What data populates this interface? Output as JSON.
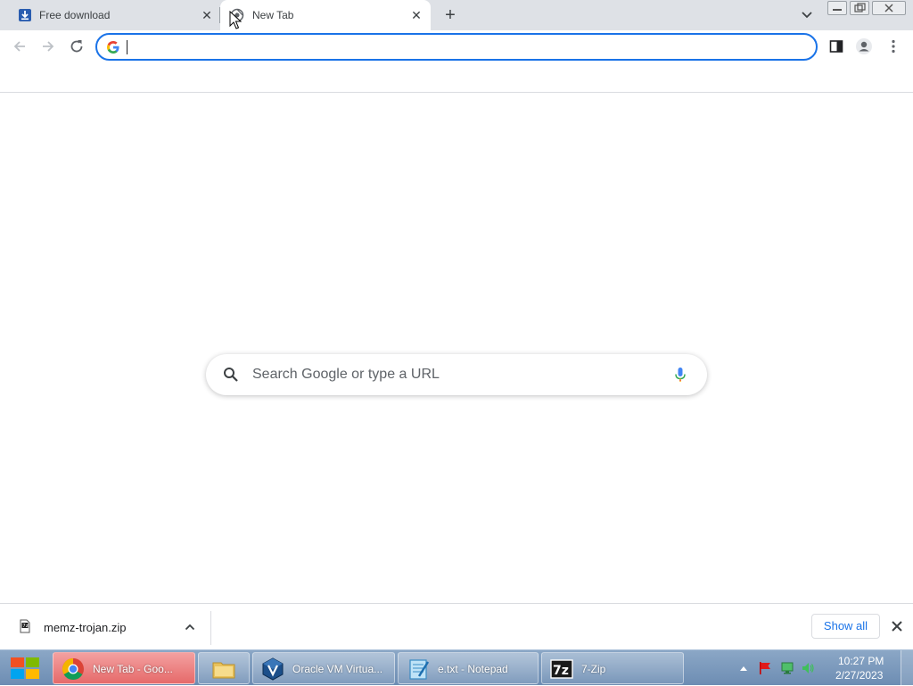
{
  "browser": {
    "tabs": [
      {
        "title": "Free download",
        "favicon": "download-arrow-icon",
        "active": false
      },
      {
        "title": "New Tab",
        "favicon": "chrome-newtab-icon",
        "active": true
      }
    ],
    "omnibox": {
      "value": "",
      "placeholder": ""
    },
    "ntp_search": {
      "placeholder": "Search Google or type a URL"
    }
  },
  "download_shelf": {
    "item": {
      "filename": "memz-trojan.zip",
      "icon": "7zip-archive-icon"
    },
    "show_all_label": "Show all"
  },
  "taskbar": {
    "tasks": [
      {
        "label": "New Tab - Goo...",
        "icon": "chrome-icon",
        "active": true
      },
      {
        "label": "",
        "icon": "folder-icon",
        "active": false
      },
      {
        "label": "Oracle VM Virtua...",
        "icon": "virtualbox-icon",
        "active": false
      },
      {
        "label": "e.txt - Notepad",
        "icon": "notepad-icon",
        "active": false
      },
      {
        "label": "7-Zip",
        "icon": "7zip-icon",
        "active": false
      }
    ],
    "clock": {
      "time": "10:27 PM",
      "date": "2/27/2023"
    }
  },
  "colors": {
    "accent": "#1a73e8",
    "tabstrip": "#dee1e6",
    "taskbar": "#7896bb",
    "active_task": "#e97b7b"
  }
}
